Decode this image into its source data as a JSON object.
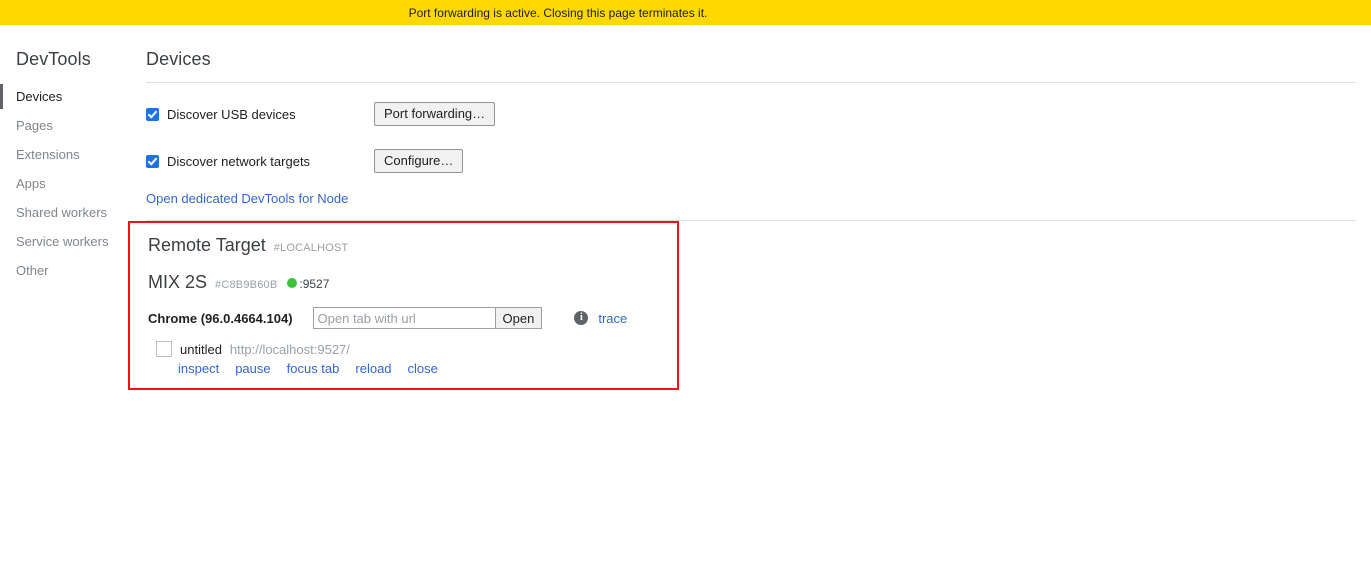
{
  "banner": {
    "message": "Port forwarding is active. Closing this page terminates it.",
    "background": "#ffd800"
  },
  "sidebar": {
    "title": "DevTools",
    "items": [
      {
        "label": "Devices",
        "selected": true
      },
      {
        "label": "Pages",
        "selected": false
      },
      {
        "label": "Extensions",
        "selected": false
      },
      {
        "label": "Apps",
        "selected": false
      },
      {
        "label": "Shared workers",
        "selected": false
      },
      {
        "label": "Service workers",
        "selected": false
      },
      {
        "label": "Other",
        "selected": false
      }
    ]
  },
  "main": {
    "page_title": "Devices",
    "discovery": {
      "usb": {
        "label": "Discover USB devices",
        "checked": true,
        "button": "Port forwarding…"
      },
      "network": {
        "label": "Discover network targets",
        "checked": true,
        "button": "Configure…"
      },
      "node_link": "Open dedicated DevTools for Node"
    },
    "remote_target": {
      "title": "Remote Target",
      "host": "#LOCALHOST",
      "device": {
        "name": "MIX 2S",
        "serial": "#C8B9B60B",
        "status_color": "#3cc23c",
        "port": ":9527"
      },
      "browser": {
        "name": "Chrome (96.0.4664.104)",
        "url_placeholder": "Open tab with url",
        "url_value": "",
        "open_button": "Open",
        "info_icon": "info-icon",
        "trace_link": "trace"
      },
      "tabs": [
        {
          "title": "untitled",
          "url": "http://localhost:9527/",
          "actions": [
            "inspect",
            "pause",
            "focus tab",
            "reload",
            "close"
          ]
        }
      ]
    },
    "annotation_color": "#fc0d1b"
  }
}
